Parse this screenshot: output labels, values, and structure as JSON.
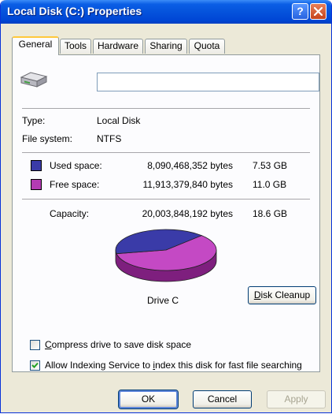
{
  "window": {
    "title": "Local Disk (C:) Properties",
    "help_label": "?"
  },
  "tabs": [
    {
      "label": "General",
      "active": true
    },
    {
      "label": "Tools",
      "active": false
    },
    {
      "label": "Hardware",
      "active": false
    },
    {
      "label": "Sharing",
      "active": false
    },
    {
      "label": "Quota",
      "active": false
    }
  ],
  "general": {
    "name_value": "",
    "type_label": "Type:",
    "type_value": "Local Disk",
    "fs_label": "File system:",
    "fs_value": "NTFS",
    "used": {
      "label": "Used space:",
      "bytes": "8,090,468,352 bytes",
      "size": "7.53 GB",
      "color": "#3a3ba8"
    },
    "free": {
      "label": "Free space:",
      "bytes": "11,913,379,840 bytes",
      "size": "11.0 GB",
      "color": "#b33bb3"
    },
    "capacity": {
      "label": "Capacity:",
      "bytes": "20,003,848,192 bytes",
      "size": "18.6 GB"
    },
    "used_fraction": 0.404,
    "drive_label": "Drive C",
    "cleanup_button": {
      "mnemonic": "D",
      "rest": "isk Cleanup"
    }
  },
  "options": {
    "compress": {
      "mnemonic": "C",
      "rest": "ompress drive to save disk space",
      "checked": false
    },
    "index": {
      "before": "Allow Indexing Service to ",
      "mnemonic": "i",
      "after": "ndex this disk for fast file searching",
      "checked": true
    }
  },
  "buttons": {
    "ok": "OK",
    "cancel": "Cancel",
    "apply": "Apply"
  }
}
